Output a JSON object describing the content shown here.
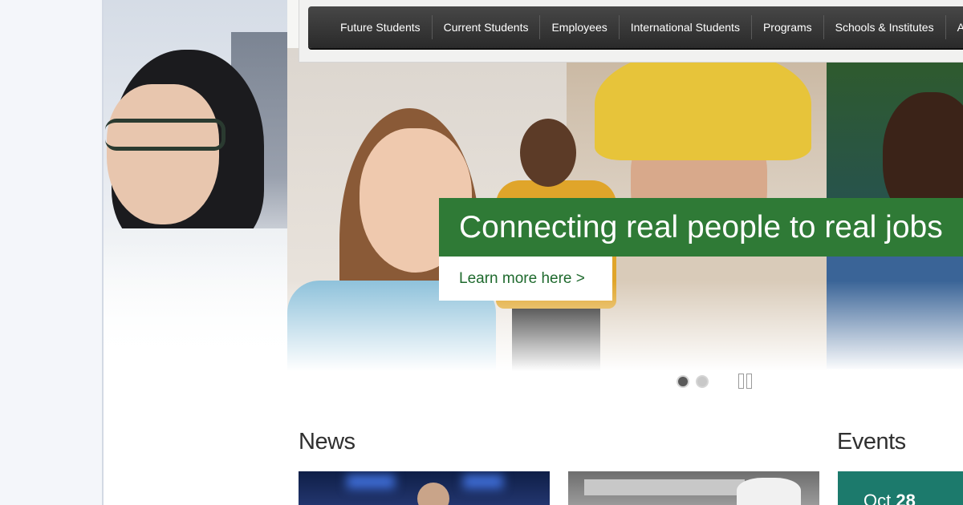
{
  "nav": {
    "items": [
      {
        "label": "Future Students"
      },
      {
        "label": "Current Students"
      },
      {
        "label": "Employees"
      },
      {
        "label": "International Students"
      },
      {
        "label": "Programs"
      },
      {
        "label": "Schools & Institutes"
      },
      {
        "label": "A"
      }
    ]
  },
  "hero": {
    "headline": "Connecting real people to real jobs",
    "cta_label": "Learn more here >",
    "slides": [
      {
        "active": true
      },
      {
        "active": false
      }
    ]
  },
  "sections": {
    "news_title": "News",
    "events_title": "Events"
  },
  "events": [
    {
      "month": "Oct",
      "day": "28"
    }
  ],
  "colors": {
    "nav_bg": "#333333",
    "caption_green": "#2f7a36",
    "cta_text": "#1f6a2e",
    "event_teal": "#1c7a6c"
  },
  "icons": {
    "slide_dot": "dot-icon",
    "pause": "pause-icon"
  }
}
